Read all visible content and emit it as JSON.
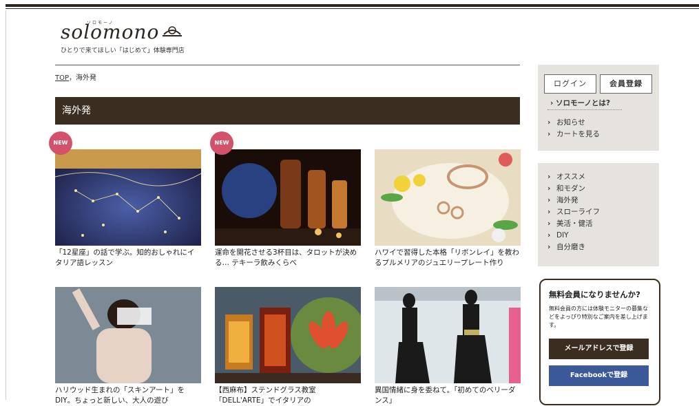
{
  "logo": {
    "name": "solomono",
    "kana": "ソロモーノ",
    "tagline": "ひとりで来てほしい「はじめて」体験専門店"
  },
  "breadcrumb": {
    "top": "TOP",
    "sep": "，",
    "current": "海外発"
  },
  "category": {
    "title": "海外発"
  },
  "new_badge": "NEW",
  "articles": [
    {
      "caption": "「12星座」の話で学ぶ。知的おしゃれにイタリア語レッスン",
      "new": true
    },
    {
      "caption": "運命を開花させる3杯目は、タロットが決める… テキーラ飲みくらべ",
      "new": true
    },
    {
      "caption": "ハワイで習得した本格「リボンレイ」を教わるプルメリアのジュエリープレート作り",
      "new": false
    },
    {
      "caption": "ハリウッド生まれの「スキンアート」をDIY。ちょっと新しい、大人の遊び",
      "new": false
    },
    {
      "caption": "【西麻布】ステンドグラス教室「DELL'ARTE」でイタリアの",
      "new": false
    },
    {
      "caption": "異国情緒に身を委ねて。「初めてのベリーダンス」",
      "new": false
    }
  ],
  "sidebar": {
    "login": "ログイン",
    "register": "会員登録",
    "about": "ソロモーノとは?",
    "links": [
      "お知らせ",
      "カートを見る"
    ],
    "categories": [
      "オススメ",
      "和モダン",
      "海外発",
      "スローライフ",
      "美活・健活",
      "DIY",
      "自分磨き"
    ]
  },
  "signup": {
    "title": "無料会員になりませんか?",
    "desc": "無料会員の方には体験モニターの募集などをよっぴり特別なご案内を差し上げます。",
    "mail": "メールアドレスで登録",
    "facebook": "Facebookで登録"
  }
}
